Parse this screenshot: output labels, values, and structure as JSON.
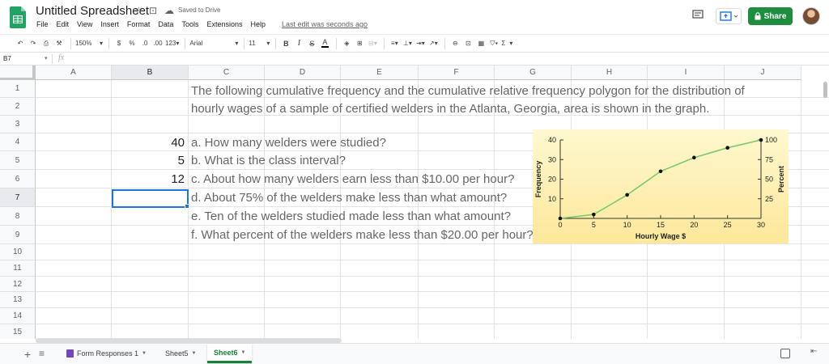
{
  "app": {
    "doc_title": "Untitled Spreadsheet",
    "saved_status": "Saved to Drive",
    "share_label": "Share",
    "menu": [
      "File",
      "Edit",
      "View",
      "Insert",
      "Format",
      "Data",
      "Tools",
      "Extensions",
      "Help"
    ],
    "last_edit": "Last edit was seconds ago"
  },
  "toolbar": {
    "zoom": "150%",
    "currency": "$",
    "percent": "%",
    "decrease_decimals": ".0",
    "increase_decimals": ".00",
    "more_formats": "123",
    "font": "Arial",
    "font_size": "11",
    "bold": "B",
    "italic": "I",
    "strike": "S",
    "text_color": "A",
    "functions": "Σ"
  },
  "formula_bar": {
    "name_box": "B7",
    "fx": "fx",
    "content": ""
  },
  "columns": [
    "A",
    "B",
    "C",
    "D",
    "E",
    "F",
    "G",
    "H",
    "I",
    "J"
  ],
  "rows": [
    "1",
    "2",
    "3",
    "4",
    "5",
    "6",
    "7",
    "8",
    "9",
    "10",
    "11",
    "12",
    "13",
    "14",
    "15"
  ],
  "cells": {
    "C1": "The following cumulative frequency and the cumulative relative frequency polygon for the distribution of",
    "C2": "hourly wages of a sample of certified welders in the Atlanta, Georgia, area is shown in the graph.",
    "B4": "40",
    "C4": "a. How many welders were studied?",
    "B5": "5",
    "C5": "b. What is the class interval?",
    "B6": "12",
    "C6": "c. About how many welders earn less than $10.00 per hour?",
    "C7": "d. About 75% of the welders make less than what amount?",
    "C8": "e. Ten of the welders studied made less than what amount?",
    "C9": "f. What percent of the welders make less than $20.00 per hour?"
  },
  "selected_cell": "B7",
  "sheets": {
    "tabs": [
      "Form Responses 1",
      "Sheet5",
      "Sheet6"
    ],
    "active": "Sheet6"
  },
  "colors": {
    "share_green": "#1e8e3e",
    "selection_blue": "#1a73e8",
    "chart_bg_top": "#fff8cf",
    "chart_bg_bottom": "#fde89a",
    "chart_line": "#7ac96c"
  },
  "chart_data": {
    "type": "line",
    "x": [
      0,
      5,
      10,
      15,
      20,
      25,
      30
    ],
    "series": [
      {
        "values": [
          0,
          2,
          12,
          24,
          31,
          36,
          40
        ]
      }
    ],
    "xlabel": "Hourly Wage $",
    "ylabel": "Frequency",
    "y2label": "Percent",
    "xlim": [
      0,
      30
    ],
    "ylim": [
      0,
      40
    ],
    "y2lim": [
      0,
      100
    ],
    "x_ticks": [
      "0",
      "5",
      "10",
      "15",
      "20",
      "25",
      "30"
    ],
    "y_ticks": [
      "10",
      "20",
      "30",
      "40"
    ],
    "y2_ticks": [
      "25",
      "50",
      "75",
      "100"
    ],
    "grid": false
  }
}
